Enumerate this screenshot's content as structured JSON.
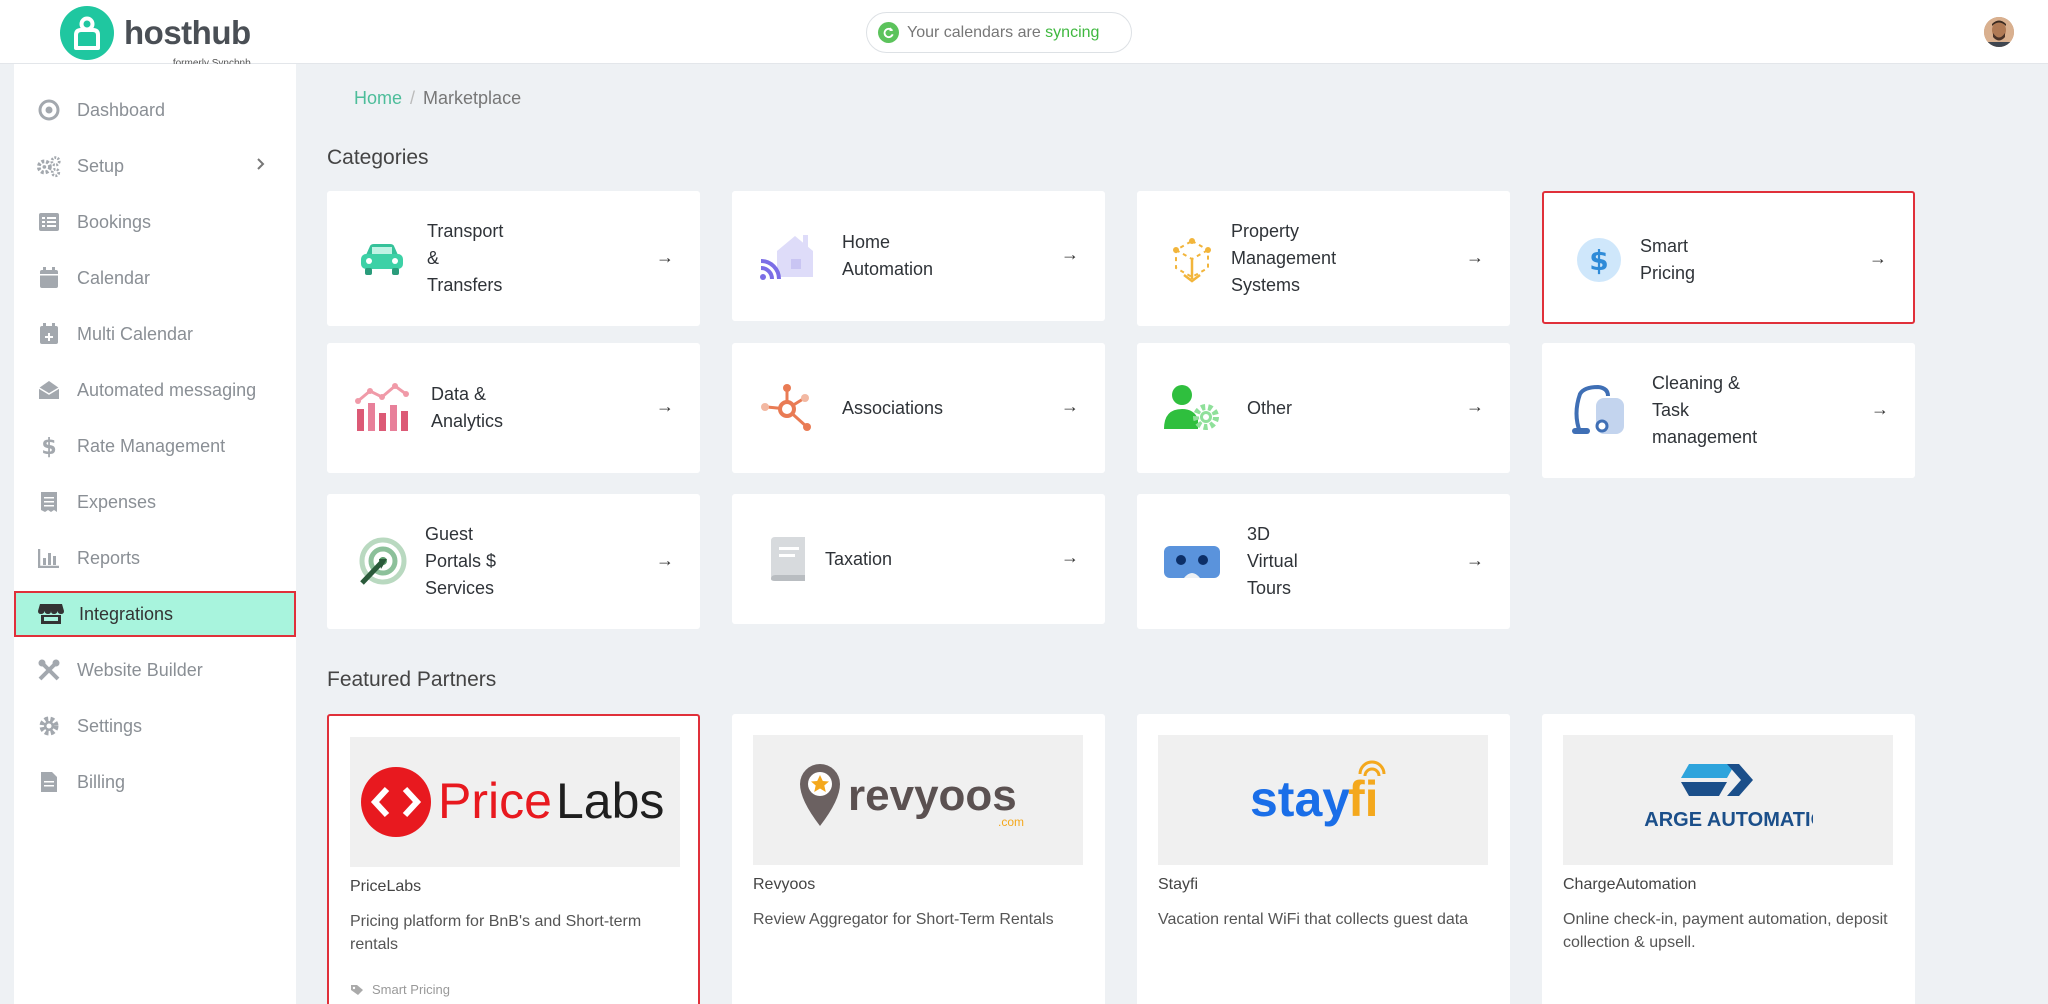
{
  "brand": {
    "name": "hosthub",
    "subtitle": "formerly Syncbnb",
    "color": "#1fc7a0"
  },
  "sync": {
    "text": "Your calendars are ",
    "status": "syncing"
  },
  "sidebar": {
    "items": [
      {
        "label": "Dashboard",
        "icon": "dashboard-icon"
      },
      {
        "label": "Setup",
        "icon": "gears-icon"
      },
      {
        "label": "Bookings",
        "icon": "list-icon"
      },
      {
        "label": "Calendar",
        "icon": "calendar-icon"
      },
      {
        "label": "Multi Calendar",
        "icon": "calendar-plus-icon"
      },
      {
        "label": "Automated messaging",
        "icon": "envelope-open-icon"
      },
      {
        "label": "Rate Management",
        "icon": "dollar-icon"
      },
      {
        "label": "Expenses",
        "icon": "receipt-icon"
      },
      {
        "label": "Reports",
        "icon": "bar-chart-icon"
      },
      {
        "label": "Integrations",
        "icon": "store-icon",
        "active": true
      },
      {
        "label": "Website Builder",
        "icon": "tools-icon"
      },
      {
        "label": "Settings",
        "icon": "gear-icon"
      },
      {
        "label": "Billing",
        "icon": "file-icon"
      }
    ]
  },
  "breadcrumb": {
    "home": "Home",
    "separator": "/",
    "current": "Marketplace"
  },
  "categories_title": "Categories",
  "categories": [
    {
      "label": "Transport & Transfers",
      "lines": [
        "Transport",
        "&",
        "Transfers"
      ],
      "icon": "car-icon"
    },
    {
      "label": "Home Automation",
      "lines": [
        "Home",
        "Automation"
      ],
      "icon": "smart-home-icon"
    },
    {
      "label": "Property Management Systems",
      "lines": [
        "Property",
        "Management",
        "Systems"
      ],
      "icon": "cube-network-icon"
    },
    {
      "label": "Smart Pricing",
      "lines": [
        "Smart",
        "Pricing"
      ],
      "icon": "dollar-coin-icon"
    },
    {
      "label": "Data & Analytics",
      "lines": [
        "Data &",
        "Analytics"
      ],
      "icon": "analytics-chart-icon"
    },
    {
      "label": "Associations",
      "lines": [
        "Associations"
      ],
      "icon": "hub-nodes-icon"
    },
    {
      "label": "Other",
      "lines": [
        "Other"
      ],
      "icon": "user-gear-icon"
    },
    {
      "label": "Cleaning & Task management",
      "lines": [
        "Cleaning &",
        "Task",
        "management"
      ],
      "icon": "vacuum-icon"
    },
    {
      "label": "Guest Portals $ Services",
      "lines": [
        "Guest",
        "Portals $",
        "Services"
      ],
      "icon": "target-arrow-icon"
    },
    {
      "label": "Taxation",
      "lines": [
        "Taxation"
      ],
      "icon": "book-icon"
    },
    {
      "label": "3D Virtual Tours",
      "lines": [
        "3D",
        "Virtual",
        "Tours"
      ],
      "icon": "vr-headset-icon"
    }
  ],
  "arrow": "→",
  "featured_title": "Featured Partners",
  "partners": [
    {
      "name": "PriceLabs",
      "logo_text": "PriceLabs",
      "description": "Pricing platform for BnB's and Short-term rentals",
      "tag": "Smart Pricing"
    },
    {
      "name": "Revyoos",
      "logo_text": "revyoos",
      "logo_sub": ".com",
      "description": "Review Aggregator for Short-Term Rentals"
    },
    {
      "name": "Stayfi",
      "logo_text": "stayfi",
      "description": "Vacation rental WiFi that collects guest data"
    },
    {
      "name": "ChargeAutomation",
      "logo_text": "CHARGE AUTOMATION",
      "description": "Online check-in, payment automation, deposit collection & upsell."
    }
  ]
}
